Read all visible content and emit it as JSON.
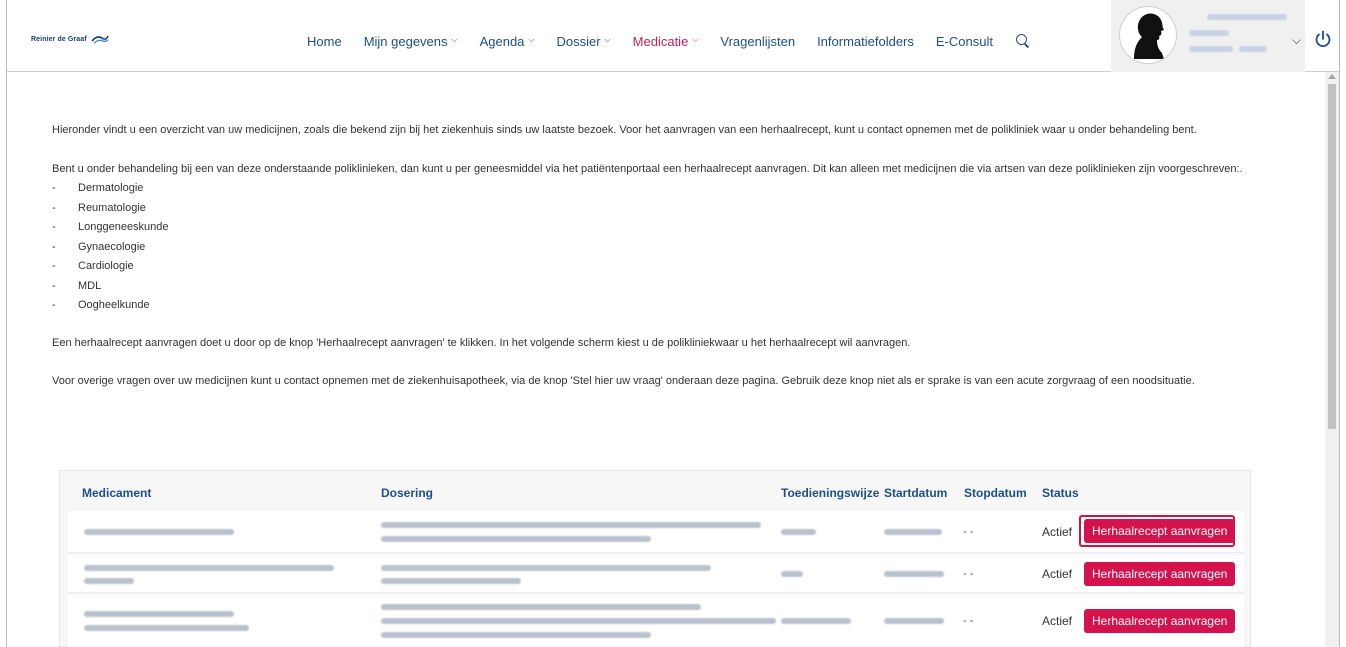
{
  "header": {
    "logo_text": "Reinier de Graaf",
    "nav": [
      {
        "label": "Home",
        "dropdown": false,
        "active": false
      },
      {
        "label": "Mijn gegevens",
        "dropdown": true,
        "active": false
      },
      {
        "label": "Agenda",
        "dropdown": true,
        "active": false
      },
      {
        "label": "Dossier",
        "dropdown": true,
        "active": false
      },
      {
        "label": "Medicatie",
        "dropdown": true,
        "active": true
      },
      {
        "label": "Vragenlijsten",
        "dropdown": false,
        "active": false
      },
      {
        "label": "Informatiefolders",
        "dropdown": false,
        "active": false
      },
      {
        "label": "E-Consult",
        "dropdown": false,
        "active": false
      }
    ],
    "icons": {
      "search": "search-icon",
      "user_menu": "chevron-down-icon",
      "logout": "power-icon"
    }
  },
  "content": {
    "intro": "Hieronder vindt u een overzicht van uw medicijnen, zoals die bekend zijn bij het ziekenhuis sinds uw laatste bezoek. Voor het aanvragen van een herhaalrecept, kunt u contact opnemen met de polikliniek waar u onder behandeling bent.",
    "polikliniek_intro": "Bent u onder behandeling bij een van deze onderstaande poliklinieken, dan kunt u per geneesmiddel via het patiëntenportaal een herhaalrecept aanvragen. Dit kan alleen met medicijnen die via artsen van deze poliklinieken zijn voorgeschreven:.",
    "poliklinieken": [
      "Dermatologie",
      "Reumatologie",
      "Longgeneeskunde",
      "Gynaecologie",
      "Cardiologie",
      "MDL",
      "Oogheelkunde"
    ],
    "instruction": "Een herhaalrecept aanvragen doet u door op de knop 'Herhaalrecept aanvragen' te klikken. In het volgende scherm kiest u de polikliniekwaar u het herhaalrecept wil aanvragen.",
    "other_questions": "Voor overige vragen over uw medicijnen kunt u contact opnemen met de ziekenhuisapotheek, via de knop 'Stel hier uw vraag' onderaan deze pagina. Gebruik deze knop niet als er sprake is van een acute zorgvraag of een noodsituatie."
  },
  "table": {
    "columns": [
      "Medicament",
      "Dosering",
      "Toedieningswijze",
      "Startdatum",
      "Stopdatum",
      "Status"
    ],
    "rows": [
      {
        "stopdatum": "- -",
        "status": "Actief",
        "button": "Herhaalrecept aanvragen"
      },
      {
        "stopdatum": "- -",
        "status": "Actief",
        "button": "Herhaalrecept aanvragen"
      },
      {
        "stopdatum": "- -",
        "status": "Actief",
        "button": "Herhaalrecept aanvragen"
      }
    ]
  },
  "colors": {
    "nav": "#1d4e8c",
    "active": "#c8215a",
    "button": "#d4124e"
  }
}
